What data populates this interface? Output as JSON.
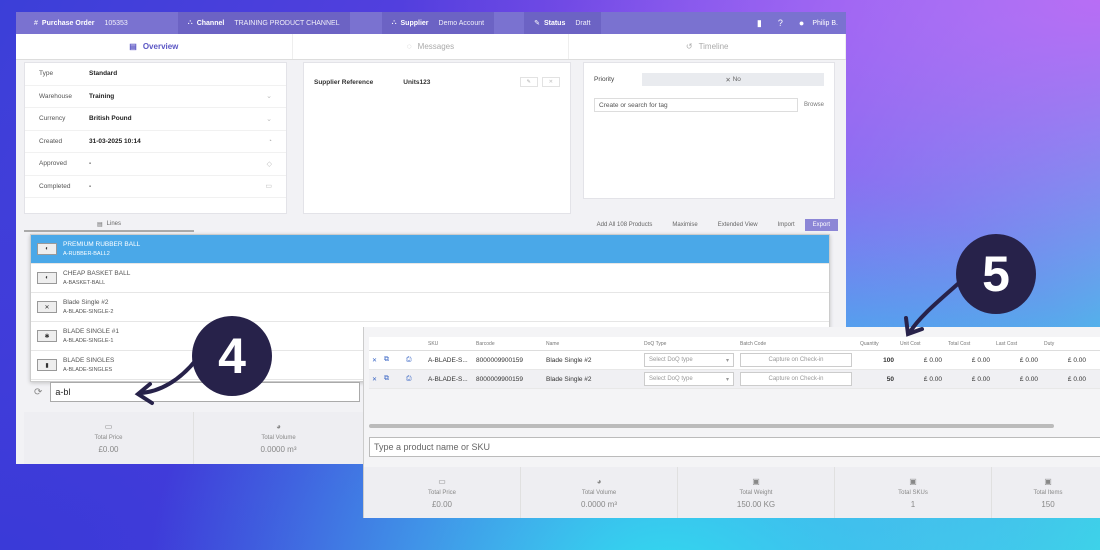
{
  "topbar": {
    "po_label": "Purchase Order",
    "po_value": "105353",
    "channel_label": "Channel",
    "channel_value": "TRAINING PRODUCT CHANNEL",
    "supplier_label": "Supplier",
    "supplier_value": "Demo Account",
    "status_label": "Status",
    "status_value": "Draft",
    "user": "Philip B."
  },
  "tabs": [
    {
      "label": "Overview",
      "icon": "overview-icon"
    },
    {
      "label": "Messages",
      "icon": "chat-icon"
    },
    {
      "label": "Timeline",
      "icon": "history-icon"
    }
  ],
  "details": [
    {
      "key": "Type",
      "value": "Standard"
    },
    {
      "key": "Warehouse",
      "value": "Training"
    },
    {
      "key": "Currency",
      "value": "British Pound"
    },
    {
      "key": "Created",
      "value": "31-03-2025 10:14"
    },
    {
      "key": "Approved",
      "value": "-"
    },
    {
      "key": "Completed",
      "value": "-"
    }
  ],
  "supplier_ref": {
    "label": "Supplier Reference",
    "value": "Units123"
  },
  "priority": {
    "label": "Priority",
    "value": "No"
  },
  "tags": {
    "placeholder": "Create or search for tag",
    "browse": "Browse"
  },
  "lines_bar": {
    "tab": "Lines",
    "add_all": "Add All 108 Products",
    "maximise": "Maximise",
    "extended": "Extended View",
    "import": "Import",
    "export": "Export"
  },
  "dropdown": [
    {
      "name": "PREMIUM RUBBER BALL",
      "sku": "A-RUBBER-BALL2",
      "active": true
    },
    {
      "name": "CHEAP BASKET BALL",
      "sku": "A-BASKET-BALL",
      "active": false
    },
    {
      "name": "Blade Single #2",
      "sku": "A-BLADE-SINGLE-2",
      "active": false
    },
    {
      "name": "BLADE SINGLE #1",
      "sku": "A-BLADE-SINGLE-1",
      "active": false
    },
    {
      "name": "BLADE SINGLES",
      "sku": "A-BLADE-SINGLES",
      "active": false
    }
  ],
  "search_value": "a-bl",
  "totals_back": [
    {
      "label": "Total Price",
      "value": "£0.00"
    },
    {
      "label": "Total Volume",
      "value": "0.0000 m³"
    }
  ],
  "table": {
    "headers": [
      "SKU",
      "Barcode",
      "Name",
      "DoQ Type",
      "Batch Code",
      "Quantity",
      "Unit Cost",
      "Total Cost",
      "Last Cost",
      "Duty"
    ],
    "rows": [
      {
        "sku": "A-BLADE-S...",
        "barcode": "8000009900159",
        "name": "Blade Single #2",
        "doq": "Select DoQ type",
        "batch": "Capture on Check-in",
        "qty": "100",
        "unit": "£ 0.00",
        "total": "£ 0.00",
        "last": "£ 0.00",
        "duty": "£ 0.00"
      },
      {
        "sku": "A-BLADE-S...",
        "barcode": "8000009900159",
        "name": "Blade Single #2",
        "doq": "Select DoQ type",
        "batch": "Capture on Check-in",
        "qty": "50",
        "unit": "£ 0.00",
        "total": "£ 0.00",
        "last": "£ 0.00",
        "duty": "£ 0.00"
      }
    ]
  },
  "product_input_placeholder": "Type a product name or SKU",
  "totals_front": [
    {
      "label": "Total Price",
      "value": "£0.00"
    },
    {
      "label": "Total Volume",
      "value": "0.0000 m³"
    },
    {
      "label": "Total Weight",
      "value": "150.00 KG"
    },
    {
      "label": "Total SKUs",
      "value": "1"
    },
    {
      "label": "Total Items",
      "value": "150"
    }
  ],
  "annotations": {
    "step_a": "4",
    "step_b": "5"
  }
}
